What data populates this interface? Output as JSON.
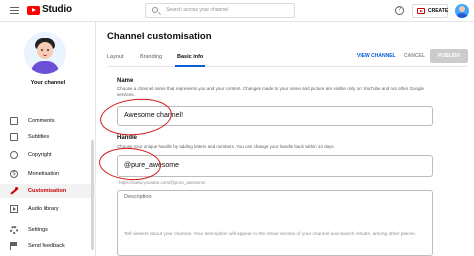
{
  "header": {
    "studio_label": "Studio",
    "search_placeholder": "Search across your channel",
    "help_glyph": "?",
    "create_label": "CREATE"
  },
  "sidebar": {
    "channel_label": "Your channel",
    "items": [
      {
        "label": "Comments",
        "icon": "comments-icon"
      },
      {
        "label": "Subtitles",
        "icon": "subtitles-icon"
      },
      {
        "label": "Copyright",
        "icon": "copyright-icon"
      },
      {
        "label": "Monetisation",
        "icon": "monetisation-icon"
      },
      {
        "label": "Customisation",
        "icon": "customisation-icon",
        "active": true
      },
      {
        "label": "Audio library",
        "icon": "audio-library-icon"
      },
      {
        "label": "Settings",
        "icon": "settings-icon"
      },
      {
        "label": "Send feedback",
        "icon": "feedback-icon"
      }
    ]
  },
  "main": {
    "title": "Channel customisation",
    "tabs": [
      {
        "label": "Layout"
      },
      {
        "label": "Branding"
      },
      {
        "label": "Basic info",
        "active": true
      }
    ],
    "actions": {
      "view_channel": "VIEW CHANNEL",
      "cancel": "CANCEL",
      "publish": "PUBLISH"
    },
    "name": {
      "label": "Name",
      "help": "Choose a channel name that represents you and your content. Changes made to your name and picture are visible only on YouTube and not other Google services.",
      "value": "Awesome channel!"
    },
    "handle": {
      "label": "Handle",
      "help": "Choose your unique handle by adding letters and numbers. You can change your handle back within 14 days.",
      "value": "@pure_awesome",
      "url": "https://www.youtube.com/@pure_awesome"
    },
    "description": {
      "label": "Description",
      "placeholder": "Tell viewers about your channel. Your description will appear in the About section of your channel and search results, among other places."
    }
  },
  "colors": {
    "accent_red": "#cc0000",
    "link_blue": "#065fd4",
    "annotation_red": "#d11a1a"
  }
}
